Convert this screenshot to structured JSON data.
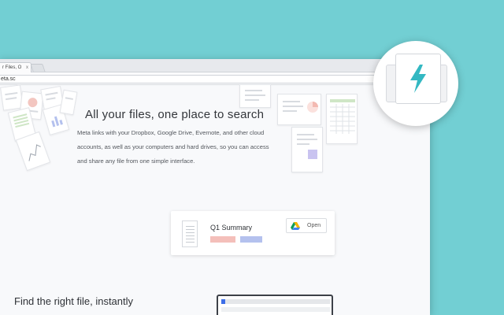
{
  "browser": {
    "tab_title": "r Files, O",
    "tab_close": "x",
    "url": "eta.sc"
  },
  "hero": {
    "title": "All your files, one place to search",
    "description": "Meta links with your Dropbox, Google Drive, Evernote, and other cloud accounts, as well as your computers and hard drives, so you can access and share any file from one simple interface."
  },
  "file_card": {
    "title": "Q1 Summary",
    "open_label": "Open",
    "tag_colors": [
      "#f4bfba",
      "#b4c1ee"
    ]
  },
  "section2": {
    "title": "Find the right file, instantly"
  },
  "extension": {
    "icon": "lightning-bolt-icon",
    "accent": "#33b8c2"
  },
  "colors": {
    "background": "#72cfd3",
    "page": "#f8f9fb"
  }
}
